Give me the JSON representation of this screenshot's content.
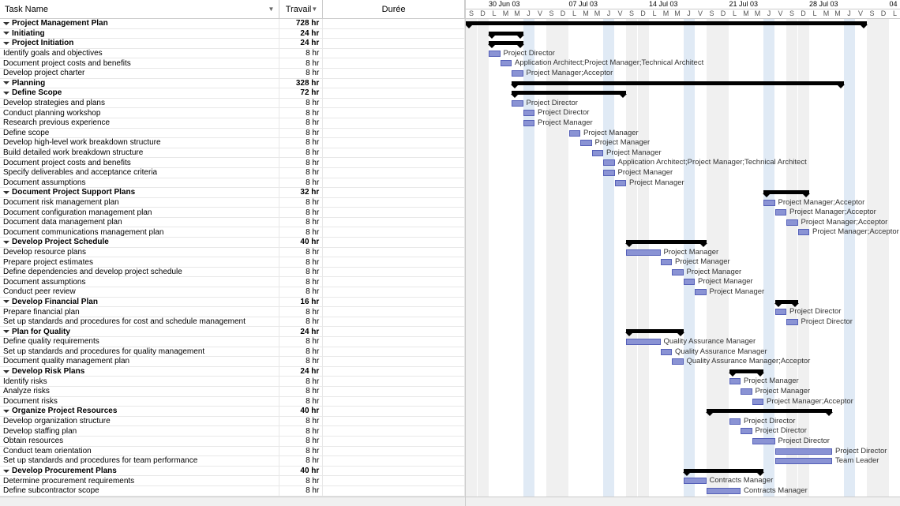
{
  "columns": {
    "name": "Task Name",
    "travail": "Travail",
    "duree": "Durée"
  },
  "timeline": {
    "weeks": [
      "30 Jun 03",
      "07 Jul 03",
      "14 Jul 03",
      "21 Jul 03",
      "28 Jul 03",
      "04"
    ],
    "days": [
      "S",
      "D",
      "L",
      "M",
      "M",
      "J",
      "V",
      "S",
      "D",
      "L",
      "M",
      "M",
      "J",
      "V",
      "S",
      "D",
      "L",
      "M",
      "M",
      "J",
      "V",
      "S",
      "D",
      "L",
      "M",
      "M",
      "J",
      "V",
      "S",
      "D",
      "L",
      "M",
      "M",
      "J",
      "V",
      "S",
      "D",
      "L"
    ]
  },
  "tasks": [
    {
      "id": 0,
      "name": "Project Management Plan",
      "trav": "728 hr",
      "ind": 0,
      "sum": true,
      "start": 0,
      "end": 35
    },
    {
      "id": 1,
      "name": "Initiating",
      "trav": "24 hr",
      "ind": 1,
      "sum": true,
      "start": 2,
      "end": 5
    },
    {
      "id": 2,
      "name": "Project Initiation",
      "trav": "24 hr",
      "ind": 2,
      "sum": true,
      "start": 2,
      "end": 5
    },
    {
      "id": 3,
      "name": "Identify goals and objectives",
      "trav": "8 hr",
      "ind": 3,
      "start": 2,
      "end": 3,
      "res": "Project Director"
    },
    {
      "id": 4,
      "name": "Document project costs and benefits",
      "trav": "8 hr",
      "ind": 3,
      "start": 3,
      "end": 4,
      "res": "Application Architect;Project Manager;Technical Architect"
    },
    {
      "id": 5,
      "name": "Develop project charter",
      "trav": "8 hr",
      "ind": 3,
      "start": 4,
      "end": 5,
      "res": "Project Manager;Acceptor"
    },
    {
      "id": 6,
      "name": "Planning",
      "trav": "328 hr",
      "ind": 1,
      "sum": true,
      "start": 4,
      "end": 33
    },
    {
      "id": 7,
      "name": "Define Scope",
      "trav": "72 hr",
      "ind": 2,
      "sum": true,
      "start": 4,
      "end": 14
    },
    {
      "id": 8,
      "name": "Develop strategies and plans",
      "trav": "8 hr",
      "ind": 3,
      "start": 4,
      "end": 5,
      "res": "Project Director"
    },
    {
      "id": 9,
      "name": "Conduct planning workshop",
      "trav": "8 hr",
      "ind": 3,
      "start": 5,
      "end": 6,
      "res": "Project Director"
    },
    {
      "id": 10,
      "name": "Research previous experience",
      "trav": "8 hr",
      "ind": 3,
      "start": 5,
      "end": 6,
      "res": "Project Manager"
    },
    {
      "id": 11,
      "name": "Define scope",
      "trav": "8 hr",
      "ind": 3,
      "start": 9,
      "end": 10,
      "res": "Project Manager"
    },
    {
      "id": 12,
      "name": "Develop high-level work breakdown structure",
      "trav": "8 hr",
      "ind": 3,
      "start": 10,
      "end": 11,
      "res": "Project Manager"
    },
    {
      "id": 13,
      "name": "Build detailed work breakdown structure",
      "trav": "8 hr",
      "ind": 3,
      "start": 11,
      "end": 12,
      "res": "Project Manager"
    },
    {
      "id": 14,
      "name": "Document project costs and benefits",
      "trav": "8 hr",
      "ind": 3,
      "start": 12,
      "end": 13,
      "res": "Application Architect;Project Manager;Technical Architect"
    },
    {
      "id": 15,
      "name": "Specify deliverables and acceptance criteria",
      "trav": "8 hr",
      "ind": 3,
      "start": 12,
      "end": 13,
      "res": "Project Manager"
    },
    {
      "id": 16,
      "name": "Document assumptions",
      "trav": "8 hr",
      "ind": 3,
      "start": 13,
      "end": 14,
      "res": "Project Manager"
    },
    {
      "id": 17,
      "name": "Document Project Support Plans",
      "trav": "32 hr",
      "ind": 2,
      "sum": true,
      "start": 26,
      "end": 30
    },
    {
      "id": 18,
      "name": "Document risk management plan",
      "trav": "8 hr",
      "ind": 3,
      "start": 26,
      "end": 27,
      "res": "Project Manager;Acceptor"
    },
    {
      "id": 19,
      "name": "Document configuration management plan",
      "trav": "8 hr",
      "ind": 3,
      "start": 27,
      "end": 28,
      "res": "Project Manager;Acceptor"
    },
    {
      "id": 20,
      "name": "Document data management plan",
      "trav": "8 hr",
      "ind": 3,
      "start": 28,
      "end": 29,
      "res": "Project Manager;Acceptor"
    },
    {
      "id": 21,
      "name": "Document communications management plan",
      "trav": "8 hr",
      "ind": 3,
      "start": 29,
      "end": 30,
      "res": "Project Manager;Acceptor"
    },
    {
      "id": 22,
      "name": "Develop Project Schedule",
      "trav": "40 hr",
      "ind": 2,
      "sum": true,
      "start": 14,
      "end": 21
    },
    {
      "id": 23,
      "name": "Develop resource plans",
      "trav": "8 hr",
      "ind": 3,
      "start": 14,
      "end": 17,
      "res": "Project Manager"
    },
    {
      "id": 24,
      "name": "Prepare project estimates",
      "trav": "8 hr",
      "ind": 3,
      "start": 17,
      "end": 18,
      "res": "Project Manager"
    },
    {
      "id": 25,
      "name": "Define dependencies and develop project schedule",
      "trav": "8 hr",
      "ind": 3,
      "start": 18,
      "end": 19,
      "res": "Project Manager"
    },
    {
      "id": 26,
      "name": "Document assumptions",
      "trav": "8 hr",
      "ind": 3,
      "start": 19,
      "end": 20,
      "res": "Project Manager"
    },
    {
      "id": 27,
      "name": "Conduct peer review",
      "trav": "8 hr",
      "ind": 3,
      "start": 20,
      "end": 21,
      "res": "Project Manager"
    },
    {
      "id": 28,
      "name": "Develop Financial Plan",
      "trav": "16 hr",
      "ind": 2,
      "sum": true,
      "start": 27,
      "end": 29
    },
    {
      "id": 29,
      "name": "Prepare financial plan",
      "trav": "8 hr",
      "ind": 3,
      "start": 27,
      "end": 28,
      "res": "Project Director"
    },
    {
      "id": 30,
      "name": "Set up standards and procedures for cost and schedule management",
      "trav": "8 hr",
      "ind": 3,
      "start": 28,
      "end": 29,
      "res": "Project Director"
    },
    {
      "id": 31,
      "name": "Plan for Quality",
      "trav": "24 hr",
      "ind": 2,
      "sum": true,
      "start": 14,
      "end": 19
    },
    {
      "id": 32,
      "name": "Define quality requirements",
      "trav": "8 hr",
      "ind": 3,
      "start": 14,
      "end": 17,
      "res": "Quality Assurance Manager"
    },
    {
      "id": 33,
      "name": "Set up standards and procedures for quality management",
      "trav": "8 hr",
      "ind": 3,
      "start": 17,
      "end": 18,
      "res": "Quality Assurance Manager"
    },
    {
      "id": 34,
      "name": "Document quality management plan",
      "trav": "8 hr",
      "ind": 3,
      "start": 18,
      "end": 19,
      "res": "Quality Assurance Manager;Acceptor"
    },
    {
      "id": 35,
      "name": "Develop Risk Plans",
      "trav": "24 hr",
      "ind": 2,
      "sum": true,
      "start": 23,
      "end": 26
    },
    {
      "id": 36,
      "name": "Identify risks",
      "trav": "8 hr",
      "ind": 3,
      "start": 23,
      "end": 24,
      "res": "Project Manager"
    },
    {
      "id": 37,
      "name": "Analyze risks",
      "trav": "8 hr",
      "ind": 3,
      "start": 24,
      "end": 25,
      "res": "Project Manager"
    },
    {
      "id": 38,
      "name": "Document risks",
      "trav": "8 hr",
      "ind": 3,
      "start": 25,
      "end": 26,
      "res": "Project Manager;Acceptor"
    },
    {
      "id": 39,
      "name": "Organize Project Resources",
      "trav": "40 hr",
      "ind": 2,
      "sum": true,
      "start": 21,
      "end": 32
    },
    {
      "id": 40,
      "name": "Develop organization structure",
      "trav": "8 hr",
      "ind": 3,
      "start": 23,
      "end": 24,
      "res": "Project Director"
    },
    {
      "id": 41,
      "name": "Develop staffing plan",
      "trav": "8 hr",
      "ind": 3,
      "start": 24,
      "end": 25,
      "res": "Project Director"
    },
    {
      "id": 42,
      "name": "Obtain resources",
      "trav": "8 hr",
      "ind": 3,
      "start": 25,
      "end": 27,
      "res": "Project Director"
    },
    {
      "id": 43,
      "name": "Conduct team orientation",
      "trav": "8 hr",
      "ind": 3,
      "start": 27,
      "end": 32,
      "res": "Project Director"
    },
    {
      "id": 44,
      "name": "Set up standards and procedures for team performance",
      "trav": "8 hr",
      "ind": 3,
      "start": 27,
      "end": 32,
      "res": "Team Leader"
    },
    {
      "id": 45,
      "name": "Develop Procurement Plans",
      "trav": "40 hr",
      "ind": 2,
      "sum": true,
      "start": 19,
      "end": 26
    },
    {
      "id": 46,
      "name": "Determine procurement requirements",
      "trav": "8 hr",
      "ind": 3,
      "start": 19,
      "end": 21,
      "res": "Contracts Manager"
    },
    {
      "id": 47,
      "name": "Define subcontractor scope",
      "trav": "8 hr",
      "ind": 3,
      "start": 21,
      "end": 24,
      "res": "Contracts Manager"
    }
  ]
}
